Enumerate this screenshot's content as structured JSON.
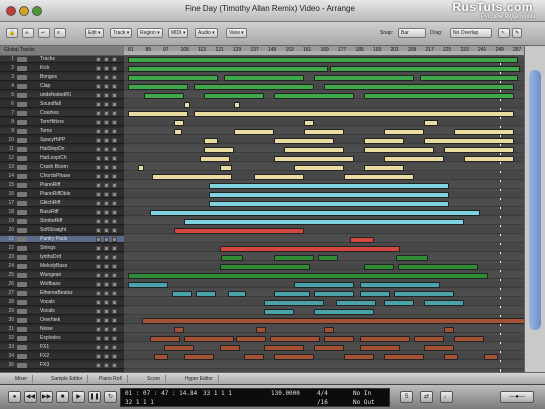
{
  "window": {
    "title": "Fine Day (Timothy Allan Remix) Video - Arrange",
    "watermark_main": "RusTuts.com",
    "watermark_sub": "Русские видеоуроки"
  },
  "toolbar": {
    "edit": "Edit ▾",
    "track": "Track ▾",
    "region": "Region ▾",
    "midi": "MIDI ▾",
    "audio": "Audio ▾",
    "view": "View ▾",
    "snap_label": "Snap:",
    "snap_value": "Bar",
    "drag_label": "Drag:",
    "drag_value": "No Overlap"
  },
  "ruler": {
    "global_tracks": "Global Tracks",
    "bars": [
      "81",
      "89",
      "97",
      "105",
      "113",
      "121",
      "129",
      "137",
      "145",
      "153",
      "161",
      "169",
      "177",
      "185",
      "193",
      "201",
      "209",
      "217",
      "225",
      "233",
      "241",
      "249",
      "257"
    ]
  },
  "tracks": [
    {
      "num": "1",
      "name": "Tracks"
    },
    {
      "num": "2",
      "name": "Kick"
    },
    {
      "num": "3",
      "name": "Bongos"
    },
    {
      "num": "4",
      "name": "Clap"
    },
    {
      "num": "5",
      "name": "undefeated/Kl"
    },
    {
      "num": "6",
      "name": "Soundfall"
    },
    {
      "num": "7",
      "name": "Crashes"
    },
    {
      "num": "8",
      "name": "TomHitters"
    },
    {
      "num": "9",
      "name": "Toms"
    },
    {
      "num": "10",
      "name": "SpacyHiPP"
    },
    {
      "num": "11",
      "name": "HatStepDo"
    },
    {
      "num": "12",
      "name": "HatLoop/Ch"
    },
    {
      "num": "13",
      "name": "Crash Boom"
    },
    {
      "num": "14",
      "name": "ChordsPhase"
    },
    {
      "num": "15",
      "name": "PianoRiff"
    },
    {
      "num": "16",
      "name": "PianoRiffDble"
    },
    {
      "num": "17",
      "name": "GlitchRiff"
    },
    {
      "num": "18",
      "name": "BassRiff"
    },
    {
      "num": "19",
      "name": "StrobeRiff"
    },
    {
      "num": "20",
      "name": "SoftStraight"
    },
    {
      "num": "21",
      "name": "Pantry Pads"
    },
    {
      "num": "22",
      "name": "Strings"
    },
    {
      "num": "23",
      "name": "lynthsDrd"
    },
    {
      "num": "24",
      "name": "MelodyBass"
    },
    {
      "num": "25",
      "name": "Wungean"
    },
    {
      "num": "26",
      "name": "Wolfbass"
    },
    {
      "num": "27",
      "name": "EthereaBeatsz"
    },
    {
      "num": "28",
      "name": "Vocals"
    },
    {
      "num": "29",
      "name": "Vocals"
    },
    {
      "num": "30",
      "name": "Overhtek"
    },
    {
      "num": "31",
      "name": "Noise"
    },
    {
      "num": "32",
      "name": "Explodes"
    },
    {
      "num": "33",
      "name": "FX1"
    },
    {
      "num": "34",
      "name": "FX2"
    },
    {
      "num": "35",
      "name": "FX3"
    }
  ],
  "bottom_buttons": [
    "Mixer",
    "Sample Editor",
    "Piano Roll",
    "Score",
    "Hyper Editor"
  ],
  "transport": {
    "position": "01 : 07 : 47 : 14.84",
    "bars": "32   1   1   1",
    "bars2": "33   1   1   1",
    "tempo": "130.0000",
    "signature": "4/4",
    "division": "/16",
    "input": "No In",
    "output": "No Out"
  },
  "colors": {
    "green": "#3ea84a",
    "cream": "#e8dca2",
    "cyan": "#7fd2e0",
    "red": "#d0483f",
    "darkgreen": "#2d8a35",
    "teal": "#49a3a8",
    "brown": "#a55135"
  }
}
